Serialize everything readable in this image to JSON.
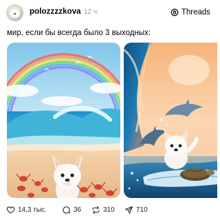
{
  "post": {
    "username": "polozzzzkova",
    "time": "12 ч.",
    "brand": "Threads",
    "caption": "мир, если бы всегда было 3 выходных:",
    "images": [
      {
        "icon": "beach-puppy-rainbow-image"
      },
      {
        "icon": "surfing-puppy-dolphins-image"
      }
    ],
    "actions": {
      "likes": "14,3 тыс.",
      "replies": "36",
      "reposts": "310",
      "shares": "710"
    }
  }
}
